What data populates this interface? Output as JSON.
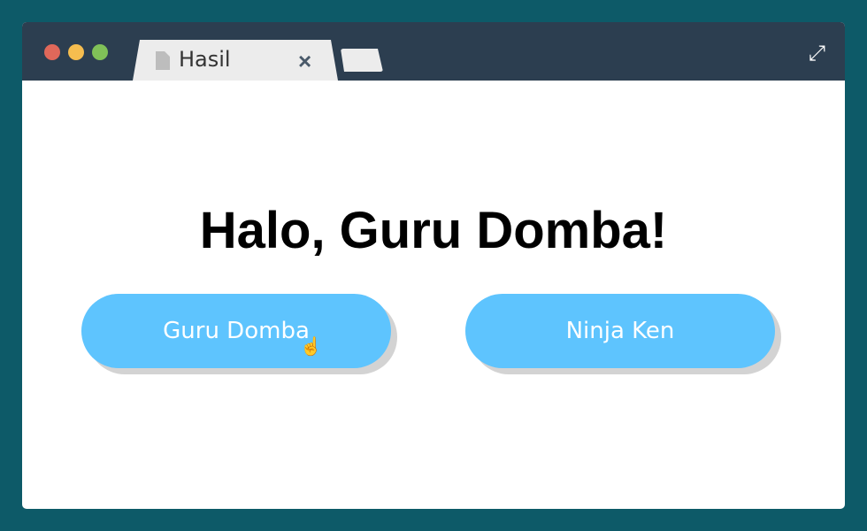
{
  "window": {
    "traffic_lights": {
      "close": "#e0685a",
      "minimize": "#f5bd4f",
      "maximize": "#80c158"
    },
    "tab": {
      "title": "Hasil",
      "icon": "file-icon",
      "close": "×"
    },
    "expand_icon": "⤢"
  },
  "main": {
    "heading": "Halo, Guru Domba!",
    "buttons": [
      {
        "label": "Guru Domba",
        "hovered": true
      },
      {
        "label": "Ninja Ken"
      }
    ],
    "button_color": "#5ec4fe",
    "cursor_icon": "pointer-hand-icon"
  }
}
